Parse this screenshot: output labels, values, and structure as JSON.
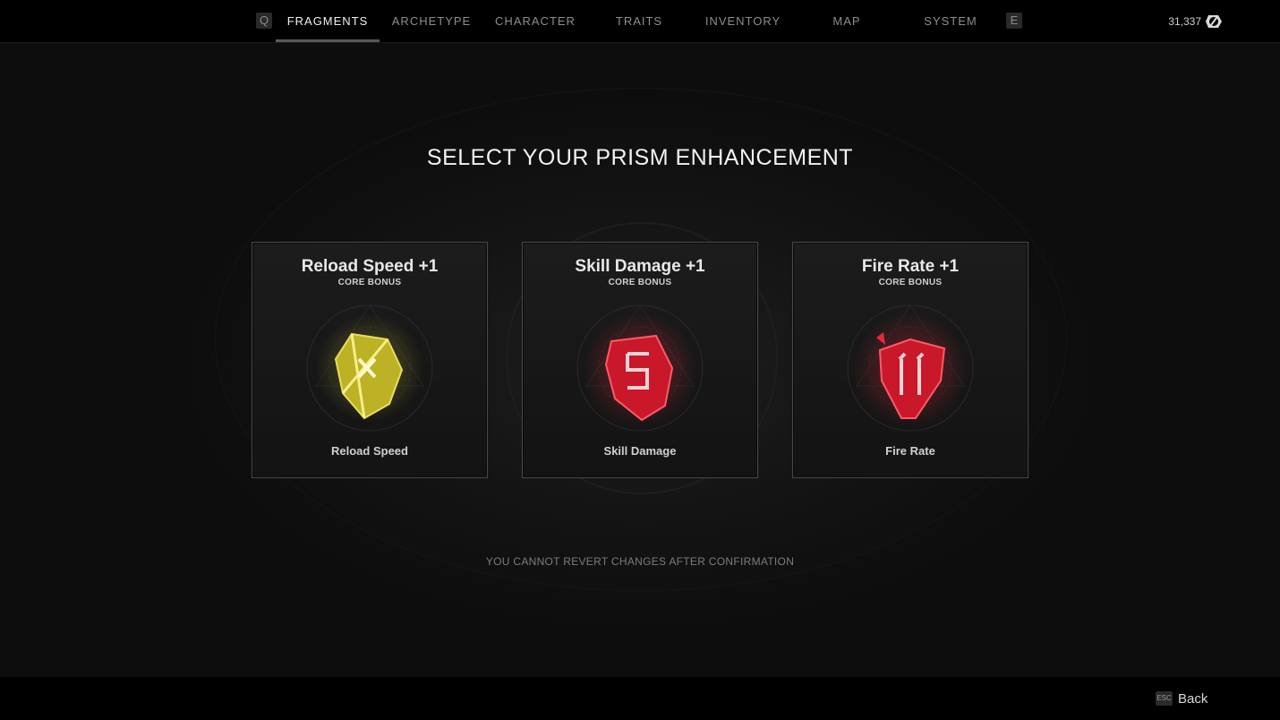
{
  "nav": {
    "prev_key": "Q",
    "next_key": "E",
    "tabs": [
      {
        "label": "FRAGMENTS",
        "active": true
      },
      {
        "label": "ARCHETYPE",
        "active": false
      },
      {
        "label": "CHARACTER",
        "active": false
      },
      {
        "label": "TRAITS",
        "active": false
      },
      {
        "label": "INVENTORY",
        "active": false
      },
      {
        "label": "MAP",
        "active": false
      },
      {
        "label": "SYSTEM",
        "active": false
      }
    ],
    "currency_amount": "31,337",
    "currency_icon": "scrap-coin-icon"
  },
  "main": {
    "heading": "SELECT YOUR PRISM ENHANCEMENT",
    "cards": [
      {
        "title": "Reload Speed +1",
        "subtitle": "CORE BONUS",
        "name": "Reload Speed",
        "crystal_color": "#e2d63a",
        "icon": "yellow-prism-crystal-icon"
      },
      {
        "title": "Skill Damage +1",
        "subtitle": "CORE BONUS",
        "name": "Skill Damage",
        "crystal_color": "#e8283a",
        "icon": "red-prism-crystal-icon"
      },
      {
        "title": "Fire Rate +1",
        "subtitle": "CORE BONUS",
        "name": "Fire Rate",
        "crystal_color": "#e8283a",
        "icon": "red-prism-crystal-icon"
      }
    ],
    "warning": "YOU CANNOT REVERT CHANGES AFTER CONFIRMATION"
  },
  "footer": {
    "back_key": "ESC",
    "back_label": "Back"
  }
}
